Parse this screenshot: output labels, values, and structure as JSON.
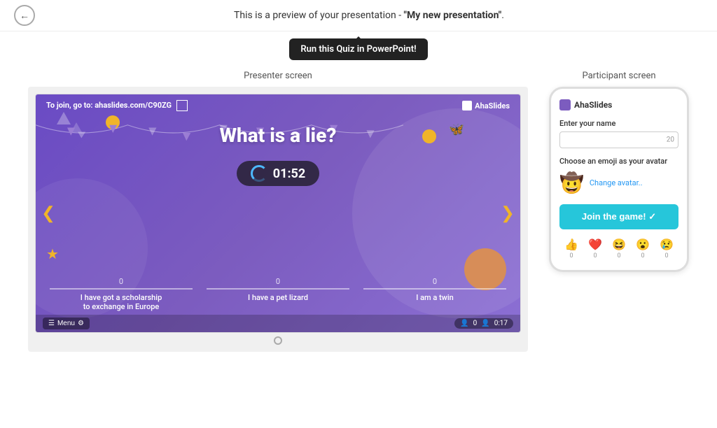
{
  "header": {
    "preview_text": "This is a preview of your presentation - ",
    "presentation_name": "\"My new presentation\"",
    "period": "."
  },
  "tooltip": {
    "label": "Run this Quiz in PowerPoint!"
  },
  "presenter": {
    "label": "Presenter screen",
    "join_text": "To join, go to: ahaslides.com/C90ZG",
    "logo": "AhaSlides",
    "quiz_title": "What is a lie?",
    "timer": "01:52",
    "answers": [
      {
        "count": "0",
        "text": "I have got a scholarship\nto exchange in Europe"
      },
      {
        "count": "0",
        "text": "I have a pet lizard"
      },
      {
        "count": "0",
        "text": "I am a twin"
      }
    ],
    "menu_label": "Menu",
    "stats_participants": "0",
    "stats_time": "0:17"
  },
  "participant": {
    "label": "Participant screen",
    "logo": "AhaSlides",
    "name_input_label": "Enter your name",
    "name_input_placeholder": "",
    "char_count": "20",
    "emoji_label": "Choose an emoji as your avatar",
    "avatar_emoji": "🤠",
    "change_avatar_label": "Change avatar..",
    "join_btn_label": "Join the game! ✓",
    "reactions": [
      {
        "emoji": "👍",
        "count": "0"
      },
      {
        "emoji": "❤️",
        "count": "0"
      },
      {
        "emoji": "😆",
        "count": "0"
      },
      {
        "emoji": "😮",
        "count": "0"
      },
      {
        "emoji": "😢",
        "count": "0"
      }
    ]
  }
}
